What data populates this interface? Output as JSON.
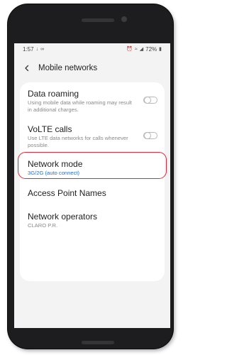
{
  "status_bar": {
    "time": "1:57",
    "battery": "72%"
  },
  "header": {
    "title": "Mobile networks"
  },
  "settings": {
    "data_roaming": {
      "title": "Data roaming",
      "subtitle": "Using mobile data while roaming may result in additional charges.",
      "enabled": false
    },
    "volte_calls": {
      "title": "VoLTE calls",
      "subtitle": "Use LTE data networks for calls whenever possible.",
      "enabled": false
    },
    "network_mode": {
      "title": "Network mode",
      "subtitle": "3G/2G (auto connect)"
    },
    "access_point_names": {
      "title": "Access Point Names"
    },
    "network_operators": {
      "title": "Network operators",
      "subtitle": "CLARO P.R."
    }
  },
  "colors": {
    "accent": "#1d6fd1",
    "highlight": "#e0283a",
    "card": "#ffffff",
    "screen_bg": "#f3f3f3"
  }
}
